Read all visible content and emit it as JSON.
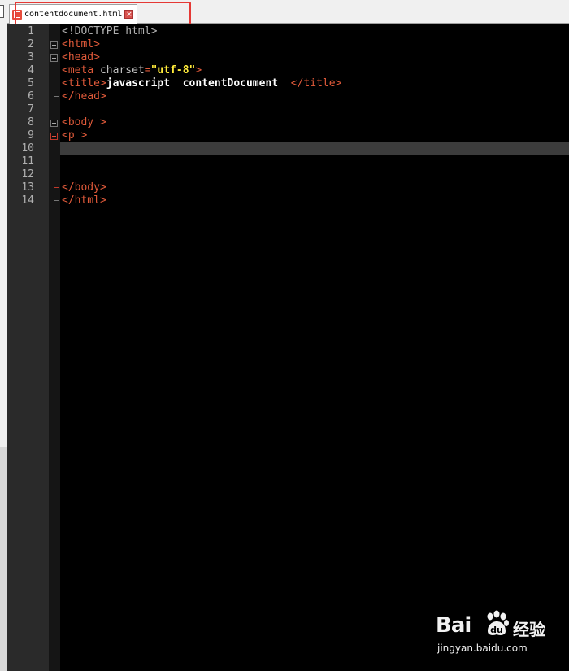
{
  "tab": {
    "filename": "contentdocument.html",
    "close_glyph": "×"
  },
  "colors": {
    "tag": "#e05a3a",
    "string": "#ffeb3b",
    "text": "#ffffff",
    "attribute": "#c0c0c0",
    "editor_bg": "#000000",
    "current_line": "#3c3c3c",
    "highlight_box": "#e53935"
  },
  "editor": {
    "current_line": 10,
    "lines": [
      {
        "num": "1",
        "doctype": "<!DOCTYPE html>"
      },
      {
        "num": "2",
        "tag": "<html>"
      },
      {
        "num": "3",
        "tag": "<head>"
      },
      {
        "num": "4",
        "tag_open": "<meta ",
        "attr": "charset",
        "eq": "=",
        "value": "\"utf-8\"",
        "tag_close": ">"
      },
      {
        "num": "5",
        "tag_open": "<title>",
        "text": "javascript  contentDocument  ",
        "tag_close": "</title>"
      },
      {
        "num": "6",
        "tag": "</head>"
      },
      {
        "num": "7"
      },
      {
        "num": "8",
        "tag": "<body >"
      },
      {
        "num": "9",
        "tag": "<p >"
      },
      {
        "num": "10"
      },
      {
        "num": "11"
      },
      {
        "num": "12"
      },
      {
        "num": "13",
        "tag": "</body>"
      },
      {
        "num": "14",
        "tag": "</html>"
      }
    ]
  },
  "watermark": {
    "brand": "Bai",
    "brand_cn": "经验",
    "url": "jingyan.baidu.com",
    "paw_icon": "paw-icon"
  }
}
